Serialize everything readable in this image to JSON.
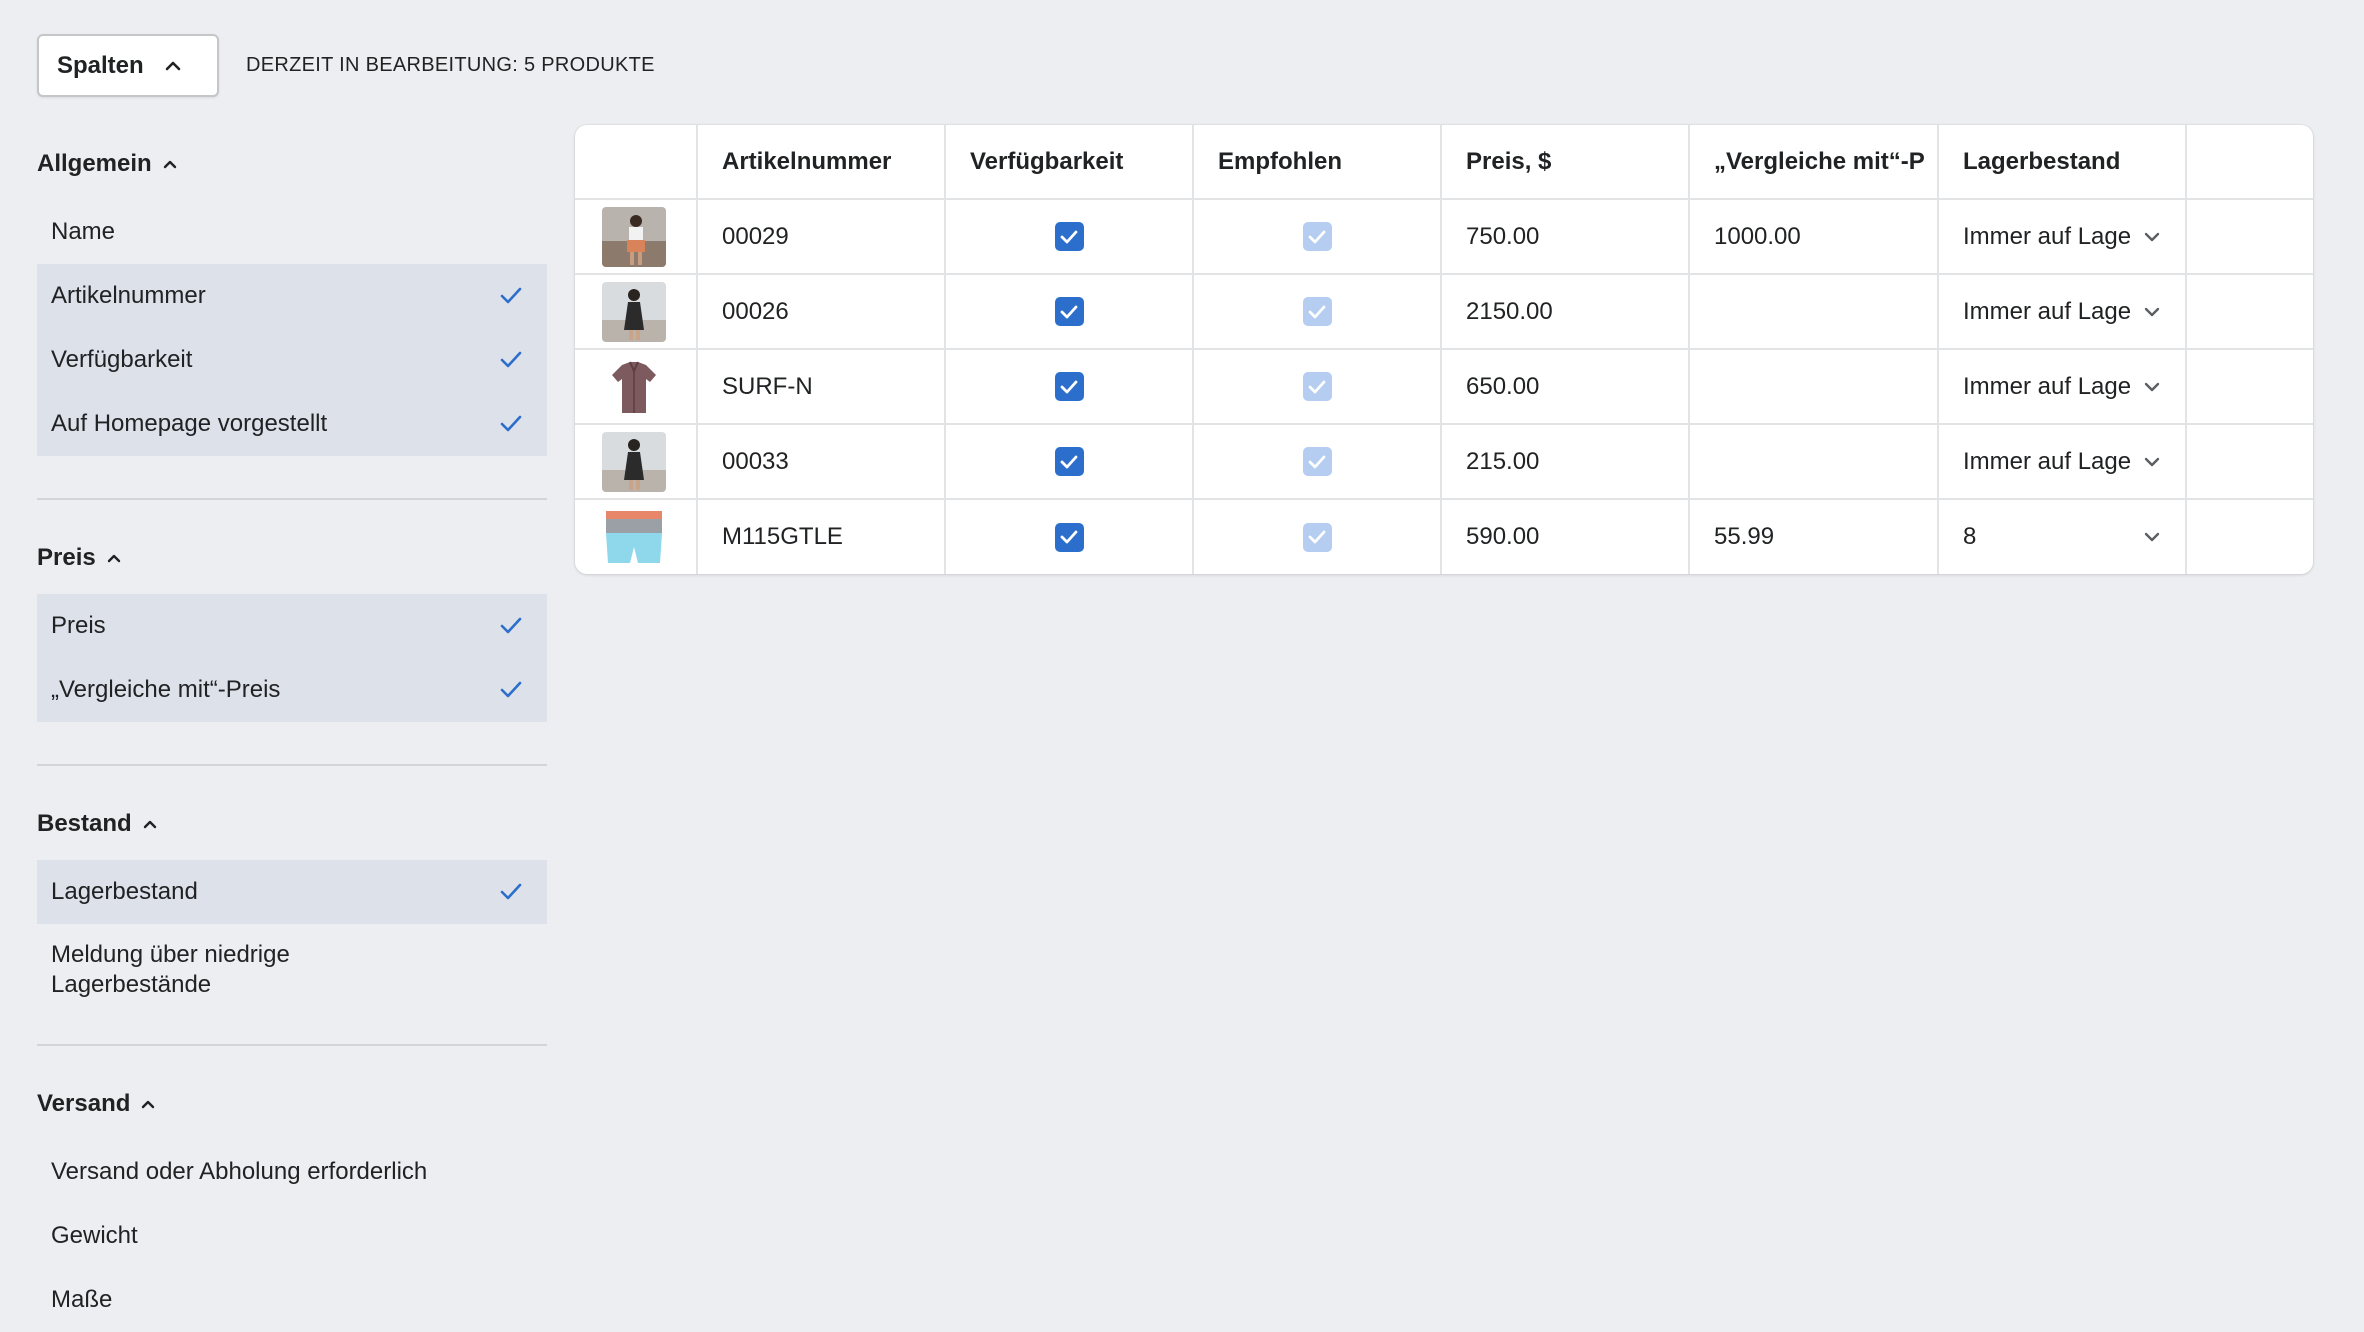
{
  "toolbar": {
    "columns_button": "Spalten",
    "editing_label": "DERZEIT IN BEARBEITUNG: 5 PRODUKTE"
  },
  "sidebar": {
    "groups": [
      {
        "title": "Allgemein",
        "items": [
          {
            "label": "Name",
            "checked": false
          },
          {
            "label": "Artikelnummer",
            "checked": true
          },
          {
            "label": "Verfügbarkeit",
            "checked": true
          },
          {
            "label": "Auf Homepage vorgestellt",
            "checked": true
          }
        ]
      },
      {
        "title": "Preis",
        "items": [
          {
            "label": "Preis",
            "checked": true
          },
          {
            "label": "„Vergleiche mit“-Preis",
            "checked": true
          }
        ]
      },
      {
        "title": "Bestand",
        "items": [
          {
            "label": "Lagerbestand",
            "checked": true
          },
          {
            "label": "Meldung über niedrige Lagerbestände",
            "checked": false
          }
        ]
      },
      {
        "title": "Versand",
        "items": [
          {
            "label": "Versand oder Abholung erforderlich",
            "checked": false
          },
          {
            "label": "Gewicht",
            "checked": false
          },
          {
            "label": "Maße",
            "checked": false
          }
        ]
      }
    ]
  },
  "table": {
    "headers": [
      "",
      "Artikelnummer",
      "Verfügbarkeit",
      "Empfohlen",
      "Preis, $",
      "„Vergleiche mit“-P",
      "Lagerbestand",
      ""
    ],
    "rows": [
      {
        "thumb": "woman-skirt-photo",
        "sku": "00029",
        "available": true,
        "featured": true,
        "price": "750.00",
        "compare": "1000.00",
        "stock": "Immer auf Lage"
      },
      {
        "thumb": "black-dress-photo",
        "sku": "00026",
        "available": true,
        "featured": true,
        "price": "2150.00",
        "compare": "",
        "stock": "Immer auf Lage"
      },
      {
        "thumb": "shirt-photo",
        "sku": "SURF-N",
        "available": true,
        "featured": true,
        "price": "650.00",
        "compare": "",
        "stock": "Immer auf Lage"
      },
      {
        "thumb": "black-dress-photo",
        "sku": "00033",
        "available": true,
        "featured": true,
        "price": "215.00",
        "compare": "",
        "stock": "Immer auf Lage"
      },
      {
        "thumb": "board-shorts-photo",
        "sku": "M115GTLE",
        "available": true,
        "featured": true,
        "price": "590.00",
        "compare": "55.99",
        "stock": "8"
      }
    ]
  },
  "colors": {
    "background": "#edeef1",
    "checked_row": "#dde1ea",
    "check_blue": "#2c6ecb",
    "check_disabled": "#b4cdf0"
  }
}
